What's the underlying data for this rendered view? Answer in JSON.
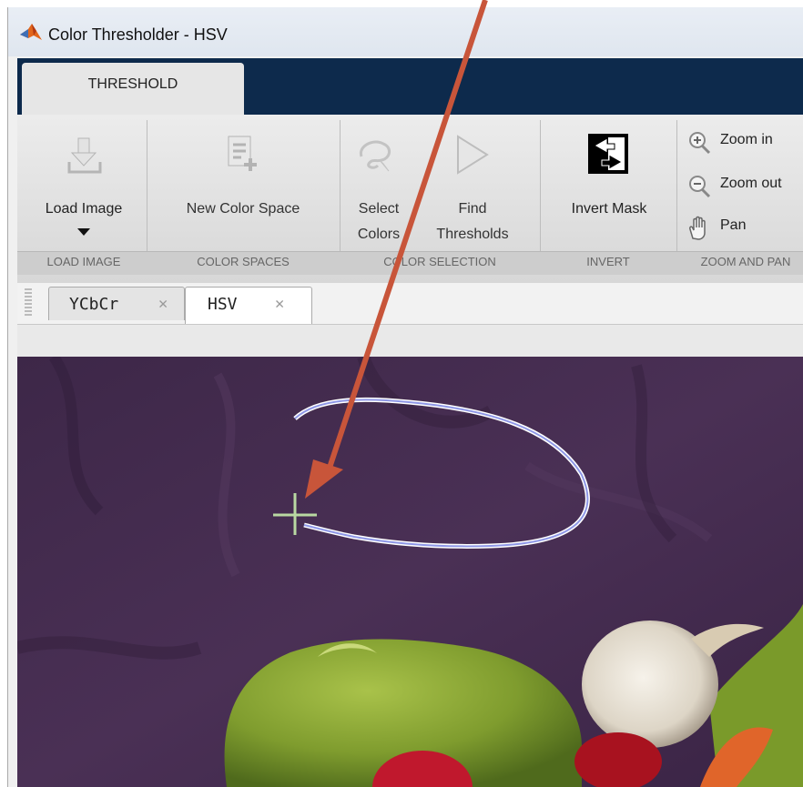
{
  "window": {
    "title": "Color Thresholder - HSV"
  },
  "ribbon_tab": {
    "label": "THRESHOLD"
  },
  "buttons": {
    "load_image": "Load Image",
    "new_color_space": "New Color Space",
    "select_colors_1": "Select",
    "select_colors_2": "Colors",
    "find_thresholds_1": "Find",
    "find_thresholds_2": "Thresholds",
    "invert_mask": "Invert Mask",
    "zoom_in": "Zoom in",
    "zoom_out": "Zoom out",
    "pan": "Pan"
  },
  "groups": {
    "load_image": "LOAD IMAGE",
    "color_spaces": "COLOR SPACES",
    "color_selection": "COLOR SELECTION",
    "invert": "INVERT",
    "zoom_and_pan": "ZOOM AND PAN"
  },
  "doc_tabs": [
    {
      "label": "YCbCr",
      "close": "✕"
    },
    {
      "label": "HSV",
      "close": "✕"
    }
  ],
  "icons": {
    "logo": "matlab-logo-icon",
    "load": "download-tray-icon",
    "new_space": "document-add-icon",
    "select": "freehand-select-icon",
    "find": "play-triangle-icon",
    "invert": "invert-mask-icon",
    "zoom_in": "magnifier-plus-icon",
    "zoom_out": "magnifier-minus-icon",
    "pan": "hand-icon",
    "crosshair": "crosshair-cursor-icon"
  },
  "colors": {
    "tab_strip": "#0d2a4c",
    "image_background": "#3f2a4a",
    "annotation_arrow": "#c8553a",
    "freehand_outline": "#b9bff0",
    "crosshair": "#b9d9a2"
  }
}
